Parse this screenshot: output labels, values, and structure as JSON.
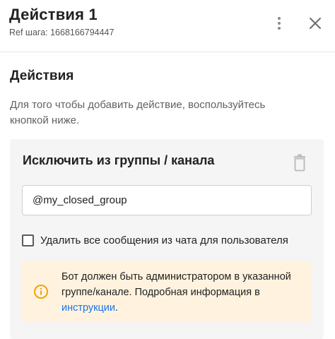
{
  "header": {
    "title": "Действия 1",
    "ref_text": "Ref шага: 1668166794447"
  },
  "section": {
    "title": "Действия",
    "description": "Для того чтобы добавить действие, воспользуйтесь кнопкой ниже."
  },
  "action_card": {
    "title": "Исключить из группы / канала",
    "group_input": {
      "value": "@my_closed_group"
    },
    "delete_messages": {
      "label": "Удалить все сообщения из чата для пользователя",
      "checked": false
    },
    "note": {
      "text": "Бот должен быть администратором в указанной группе/канале. Подробная информация в ",
      "link_text": "инструкции",
      "suffix": "."
    }
  },
  "icons": {
    "menu": "more-vert-icon",
    "close": "close-icon",
    "delete": "trash-icon",
    "info": "info-icon"
  },
  "colors": {
    "link": "#1a73e8",
    "note_background": "#fff3df",
    "info_icon": "#f0a30a",
    "card_background": "#f5f5f5"
  }
}
